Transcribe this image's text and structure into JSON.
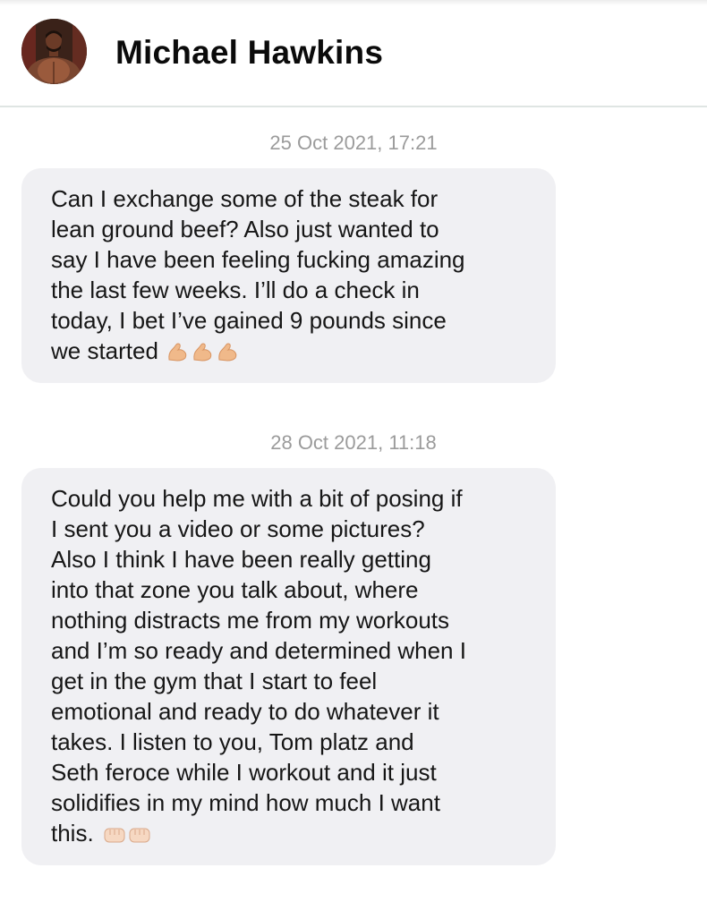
{
  "contact": {
    "name": "Michael Hawkins"
  },
  "messages": [
    {
      "timestamp": "25 Oct 2021, 17:21",
      "lines": [
        "Can I exchange some of the steak for",
        "lean ground beef? Also just wanted to",
        "say I have been feeling fucking amazing",
        "the last few weeks. I’ll do a check in",
        "today, I bet I’ve gained 9 pounds since",
        "we started"
      ],
      "emoji": "flexed-biceps-x3"
    },
    {
      "timestamp": "28 Oct 2021, 11:18",
      "lines": [
        "Could you help me with a bit of posing if",
        "I sent you a video or some pictures?",
        "Also I think I have been really getting",
        "into that zone you talk about, where",
        "nothing distracts me from my workouts",
        "and I’m so ready and determined when I",
        "get in the gym that I start to feel",
        "emotional and ready to do whatever it",
        "takes. I listen to you, Tom platz and",
        "Seth feroce while I workout and it just",
        "solidifies in my mind how much I want",
        "this."
      ],
      "emoji": "oncoming-fist-x2"
    }
  ],
  "colors": {
    "bubble": "#f0f0f3",
    "timestamp": "#9b9b9b",
    "divider": "#dfe5e3"
  }
}
